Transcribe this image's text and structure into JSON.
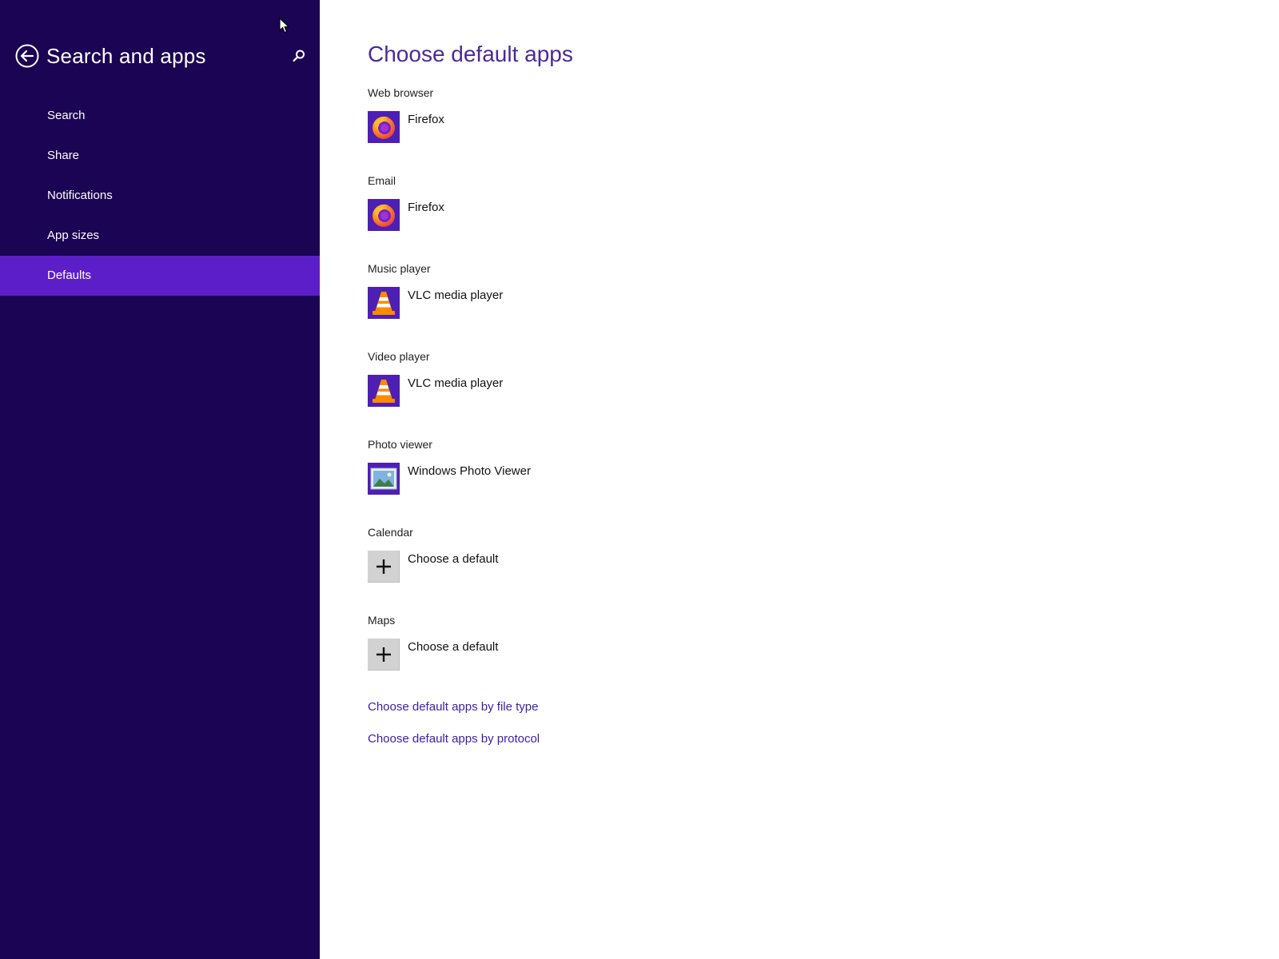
{
  "sidebar": {
    "title": "Search and apps",
    "back_icon": "back-arrow-icon",
    "search_icon": "search-icon",
    "items": [
      {
        "label": "Search"
      },
      {
        "label": "Share"
      },
      {
        "label": "Notifications"
      },
      {
        "label": "App sizes"
      },
      {
        "label": "Defaults",
        "selected": true
      }
    ]
  },
  "main": {
    "title": "Choose default apps",
    "categories": [
      {
        "label": "Web browser",
        "app": "Firefox",
        "icon": "firefox-icon"
      },
      {
        "label": "Email",
        "app": "Firefox",
        "icon": "firefox-icon"
      },
      {
        "label": "Music player",
        "app": "VLC media player",
        "icon": "vlc-icon"
      },
      {
        "label": "Video player",
        "app": "VLC media player",
        "icon": "vlc-icon"
      },
      {
        "label": "Photo viewer",
        "app": "Windows Photo Viewer",
        "icon": "photo-viewer-icon"
      },
      {
        "label": "Calendar",
        "app": "Choose a default",
        "icon": "plus-icon"
      },
      {
        "label": "Maps",
        "app": "Choose a default",
        "icon": "plus-icon"
      }
    ],
    "links": [
      {
        "label": "Choose default apps by file type"
      },
      {
        "label": "Choose default apps by protocol"
      }
    ]
  },
  "colors": {
    "sidebar_bg": "#1b0453",
    "selected_bg": "#5c1ec8",
    "title_color": "#4a2a9c",
    "link_color": "#3b1fa8",
    "tile_bg": "#4e1fb4"
  }
}
